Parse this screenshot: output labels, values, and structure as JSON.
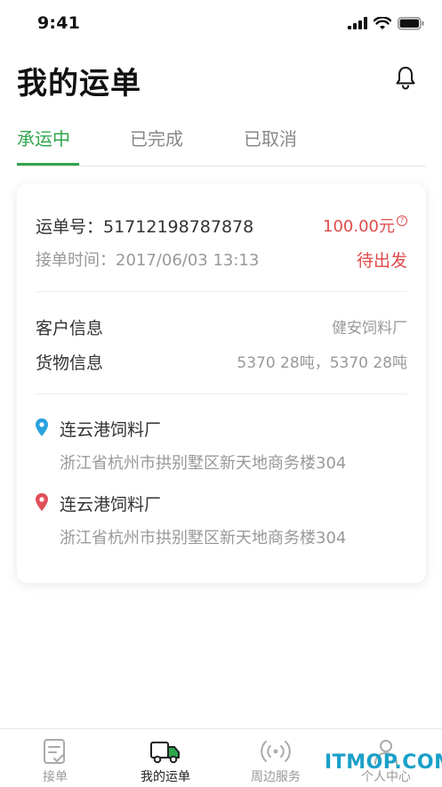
{
  "status_bar": {
    "time": "9:41"
  },
  "header": {
    "title": "我的运单"
  },
  "tabs": [
    {
      "label": "承运中"
    },
    {
      "label": "已完成"
    },
    {
      "label": "已取消"
    }
  ],
  "order": {
    "order_no": "运单号：51712198787878",
    "price": "100.00元",
    "price_help": "?",
    "accept_time": "接单时间：2017/06/03   13:13",
    "status": "待出发",
    "customer_label": "客户信息",
    "customer_value": "健安饲料厂",
    "goods_label": "货物信息",
    "goods_value": "5370  28吨，5370  28吨",
    "origin": {
      "name": "连云港饲料厂",
      "address": "浙江省杭州市拱别墅区新天地商务楼304"
    },
    "destination": {
      "name": "连云港饲料厂",
      "address": "浙江省杭州市拱别墅区新天地商务楼304"
    }
  },
  "bottom_nav": [
    {
      "label": "接单",
      "icon": "clipboard-icon"
    },
    {
      "label": "我的运单",
      "icon": "truck-icon"
    },
    {
      "label": "周边服务",
      "icon": "broadcast-icon"
    },
    {
      "label": "个人中心",
      "icon": "person-icon"
    }
  ],
  "watermark": "ITMOP.COM",
  "colors": {
    "accent": "#2fa54c",
    "price": "#e14b4b",
    "origin_pin": "#2aa3e0",
    "destination_pin": "#e0505a"
  }
}
